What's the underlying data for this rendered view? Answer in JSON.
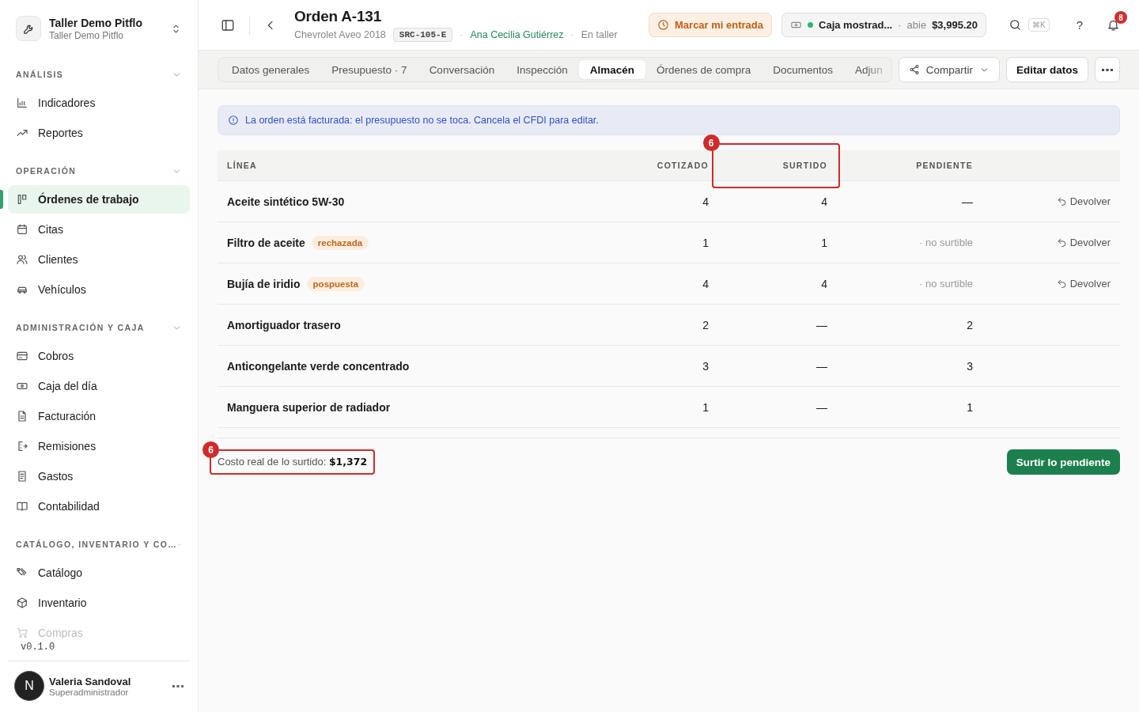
{
  "workspace": {
    "name": "Taller Demo Pitflo",
    "subtitle": "Taller Demo Pitflo"
  },
  "sidebar": {
    "sections": [
      {
        "title": "ANÁLISIS",
        "expanded": true,
        "items": [
          {
            "label": "Indicadores",
            "selected": false,
            "faded": false
          },
          {
            "label": "Reportes",
            "selected": false,
            "faded": false
          }
        ]
      },
      {
        "title": "OPERACIÓN",
        "expanded": true,
        "items": [
          {
            "label": "Órdenes de trabajo",
            "selected": true,
            "faded": false
          },
          {
            "label": "Citas",
            "selected": false,
            "faded": false
          },
          {
            "label": "Clientes",
            "selected": false,
            "faded": false
          },
          {
            "label": "Vehículos",
            "selected": false,
            "faded": false
          }
        ]
      },
      {
        "title": "ADMINISTRACIÓN Y CAJA",
        "expanded": true,
        "items": [
          {
            "label": "Cobros",
            "selected": false,
            "faded": false
          },
          {
            "label": "Caja del día",
            "selected": false,
            "faded": false
          },
          {
            "label": "Facturación",
            "selected": false,
            "faded": false
          },
          {
            "label": "Remisiones",
            "selected": false,
            "faded": false
          },
          {
            "label": "Gastos",
            "selected": false,
            "faded": false
          },
          {
            "label": "Contabilidad",
            "selected": false,
            "faded": false
          }
        ]
      },
      {
        "title": "CATÁLOGO, INVENTARIO Y CO…",
        "expanded": true,
        "items": [
          {
            "label": "Catálogo",
            "selected": false,
            "faded": false
          },
          {
            "label": "Inventario",
            "selected": false,
            "faded": false
          },
          {
            "label": "Compras",
            "selected": false,
            "faded": true
          }
        ]
      }
    ],
    "version": "v0.1.0",
    "user": {
      "initial": "N",
      "name": "Valeria Sandoval",
      "role": "Superadministrador"
    }
  },
  "header": {
    "title": "Orden A-131",
    "subtitle": [
      {
        "kind": "text",
        "text": "Chevrolet Aveo 2018"
      },
      {
        "kind": "plate",
        "text": "SRC-105-E"
      },
      {
        "kind": "separator",
        "text": "·"
      },
      {
        "kind": "link",
        "text": "Ana Cecilia Gutiérrez"
      },
      {
        "kind": "separator",
        "text": "·"
      },
      {
        "kind": "text",
        "text": "En taller"
      }
    ],
    "clock_in_button": "Marcar mi entrada",
    "cash_register": {
      "name": "Caja mostrad...",
      "separator": "·",
      "status": "abie",
      "amount": "$3,995.20",
      "open": true
    },
    "shortcut": "⌘K",
    "help": "?",
    "notifications": "8"
  },
  "tabs": [
    {
      "label": "Datos generales",
      "selected": false,
      "cut": false
    },
    {
      "label": "Presupuesto · 7",
      "selected": false,
      "cut": false
    },
    {
      "label": "Conversación",
      "selected": false,
      "cut": false
    },
    {
      "label": "Inspección",
      "selected": false,
      "cut": false
    },
    {
      "label": "Almacén",
      "selected": true,
      "cut": false
    },
    {
      "label": "Órdenes de compra",
      "selected": false,
      "cut": false
    },
    {
      "label": "Documentos",
      "selected": false,
      "cut": false
    },
    {
      "label": "Adjun",
      "selected": false,
      "cut": true
    }
  ],
  "actions": {
    "share": "Compartir",
    "edit": "Editar datos"
  },
  "alert": "La orden está facturada: el presupuesto no se toca. Cancela el CFDI para editar.",
  "table": {
    "columns": [
      {
        "label": "LÍNEA"
      },
      {
        "label": "COTIZADO"
      },
      {
        "label": "SURTIDO",
        "annotation": "6"
      },
      {
        "label": "PENDIENTE"
      }
    ],
    "rows": [
      {
        "name": "Aceite sintético 5W-30",
        "cotizado": "4",
        "surtido": "4",
        "pendiente": "—",
        "pending_muted": false,
        "action": "Devolver"
      },
      {
        "name": "Filtro de aceite",
        "tag": "rechazada",
        "cotizado": "1",
        "surtido": "1",
        "pendiente": "· no surtible",
        "pending_muted": true,
        "action": "Devolver"
      },
      {
        "name": "Bujía de iridio",
        "tag": "pospuesta",
        "cotizado": "4",
        "surtido": "4",
        "pendiente": "· no surtible",
        "pending_muted": true,
        "action": "Devolver"
      },
      {
        "name": "Amortiguador trasero",
        "cotizado": "2",
        "surtido": "—",
        "pendiente": "2",
        "pending_muted": false
      },
      {
        "name": "Anticongelante verde concentrado",
        "cotizado": "3",
        "surtido": "—",
        "pendiente": "3",
        "pending_muted": false
      },
      {
        "name": "Manguera superior de radiador",
        "cotizado": "1",
        "surtido": "—",
        "pendiente": "1",
        "pending_muted": false
      }
    ]
  },
  "footer": {
    "cost": "Costo real de lo surtido: **$1,372**",
    "annotation": "6",
    "button": "Surtir lo pendiente"
  }
}
